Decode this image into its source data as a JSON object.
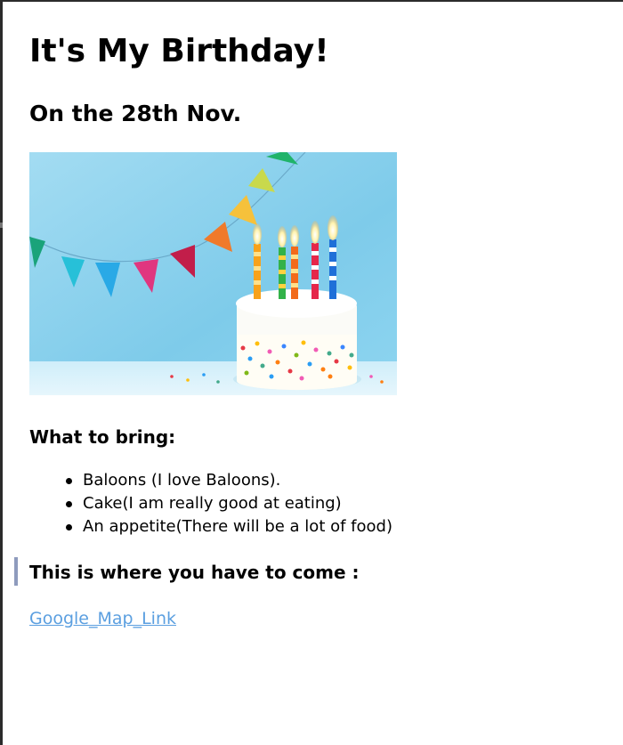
{
  "page": {
    "title": "It's My Birthday!",
    "subtitle": "On the 28th Nov."
  },
  "image": {
    "alt": "Birthday cake with candles and colorful bunting"
  },
  "bring": {
    "heading": "What to bring:",
    "items": [
      "Baloons (I love Baloons).",
      "Cake(I am really good at eating)",
      "An appetite(There will be a lot of food)"
    ]
  },
  "location": {
    "heading": "This is where you have to come :",
    "link_text": "Google_Map_Link"
  },
  "colors": {
    "link": "#5b9fe0",
    "quote_bar": "#8e9bbd",
    "image_background": "#8fd3ef"
  }
}
